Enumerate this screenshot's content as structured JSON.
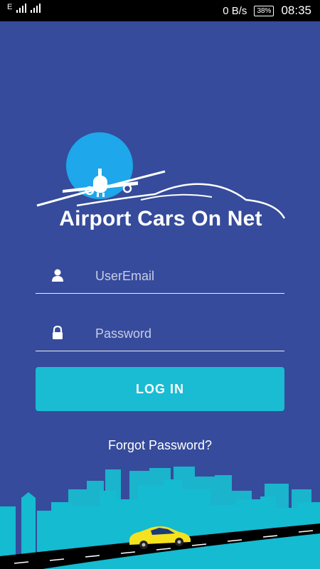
{
  "status_bar": {
    "network_letter": "E",
    "data_speed": "0 B/s",
    "battery": "38%",
    "time": "08:35"
  },
  "logo": {
    "title": "Airport Cars On Net"
  },
  "form": {
    "email_placeholder": "UserEmail",
    "password_placeholder": "Password",
    "login_label": "LOG IN",
    "forgot_label": "Forgot Password?"
  },
  "colors": {
    "background": "#364b9b",
    "accent": "#19bcd2",
    "sun": "#1ea7ea",
    "car": "#f5e11e"
  }
}
